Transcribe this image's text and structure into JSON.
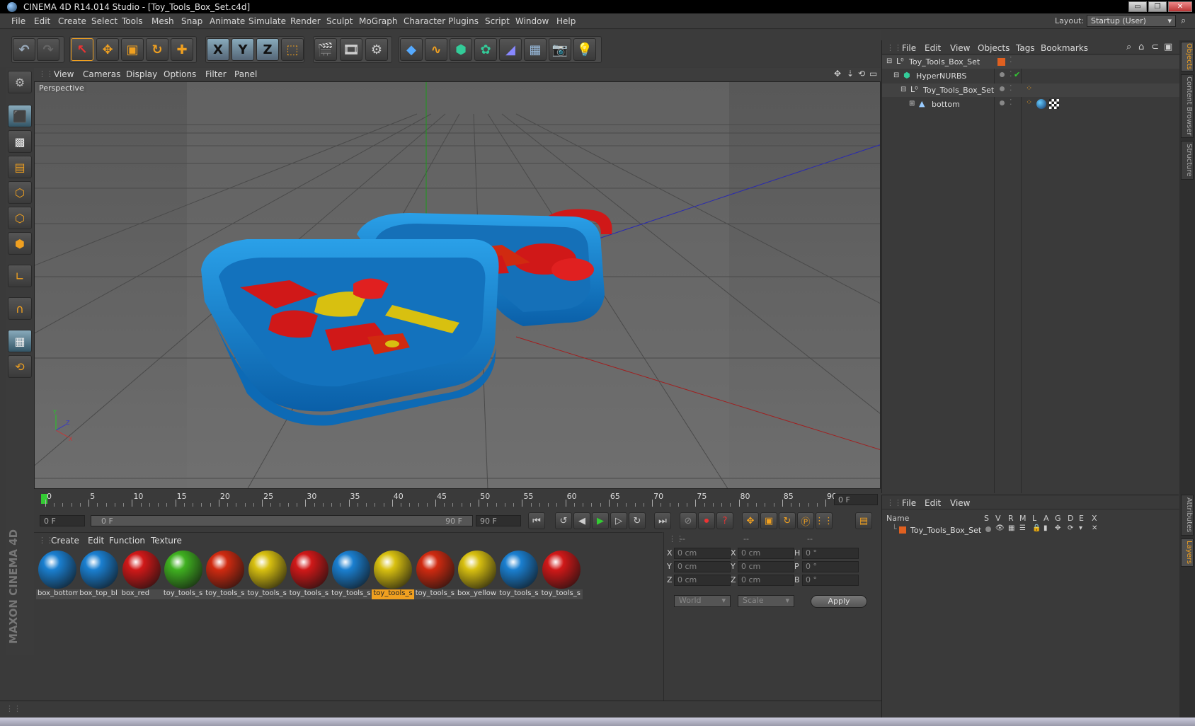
{
  "window": {
    "title": "CINEMA 4D R14.014 Studio - [Toy_Tools_Box_Set.c4d]",
    "minimize": "▭",
    "restore": "❐",
    "close": "✕"
  },
  "menubar": {
    "items": [
      "File",
      "Edit",
      "Create",
      "Select",
      "Tools",
      "Mesh",
      "Snap",
      "Animate",
      "Simulate",
      "Render",
      "Sculpt",
      "MoGraph",
      "Character",
      "Plugins",
      "Script",
      "Window",
      "Help"
    ],
    "layout_label": "Layout:",
    "layout_value": "Startup (User)"
  },
  "toolbar": {
    "axis_x": "X",
    "axis_y": "Y",
    "axis_z": "Z"
  },
  "viewport": {
    "menu": [
      "View",
      "Cameras",
      "Display",
      "Options",
      "Filter",
      "Panel"
    ],
    "camera_label": "Perspective",
    "axis_y": "Y",
    "axis_x": "X",
    "axis_z": "Z"
  },
  "timeline": {
    "ticks": [
      "0",
      "5",
      "10",
      "15",
      "20",
      "25",
      "30",
      "35",
      "40",
      "45",
      "50",
      "55",
      "60",
      "65",
      "70",
      "75",
      "80",
      "85",
      "90"
    ],
    "current_frame": "0 F",
    "start_frame": "0 F",
    "range_start": "0 F",
    "range_end": "90 F",
    "end_frame": "90 F"
  },
  "materials": {
    "menu": [
      "Create",
      "Edit",
      "Function",
      "Texture"
    ],
    "items": [
      {
        "name": "box_bottom",
        "color": "#1a7fd0"
      },
      {
        "name": "box_top_bl",
        "color": "#1a7fd0"
      },
      {
        "name": "box_red",
        "color": "#d01818"
      },
      {
        "name": "toy_tools_s",
        "color": "#3fb020"
      },
      {
        "name": "toy_tools_s",
        "color": "#d02a10"
      },
      {
        "name": "toy_tools_s",
        "color": "#d8c010"
      },
      {
        "name": "toy_tools_s",
        "color": "#d01818"
      },
      {
        "name": "toy_tools_s",
        "color": "#1a7fd0"
      },
      {
        "name": "toy_tools_s",
        "color": "#d8c010",
        "selected": true
      },
      {
        "name": "toy_tools_s",
        "color": "#d02a10"
      },
      {
        "name": "box_yellow",
        "color": "#d8c010"
      },
      {
        "name": "toy_tools_s",
        "color": "#1a7fd0"
      },
      {
        "name": "toy_tools_s",
        "color": "#d01818"
      }
    ]
  },
  "coords": {
    "headers": [
      "--",
      "--",
      "--"
    ],
    "rows": [
      {
        "a": "X",
        "pos": "0 cm",
        "b": "X",
        "size": "0 cm",
        "c": "H",
        "rot": "0 °"
      },
      {
        "a": "Y",
        "pos": "0 cm",
        "b": "Y",
        "size": "0 cm",
        "c": "P",
        "rot": "0 °"
      },
      {
        "a": "Z",
        "pos": "0 cm",
        "b": "Z",
        "size": "0 cm",
        "c": "B",
        "rot": "0 °"
      }
    ],
    "mode1": "World",
    "mode2": "Scale",
    "apply": "Apply"
  },
  "objects": {
    "menu": [
      "File",
      "Edit",
      "View",
      "Objects",
      "Tags",
      "Bookmarks"
    ],
    "tree": [
      {
        "name": "Toy_Tools_Box_Set"
      },
      {
        "name": "HyperNURBS"
      },
      {
        "name": "Toy_Tools_Box_Set"
      },
      {
        "name": "bottom"
      }
    ]
  },
  "layers": {
    "menu": [
      "File",
      "Edit",
      "View"
    ],
    "headers": [
      "Name",
      "S",
      "V",
      "R",
      "M",
      "L",
      "A",
      "G",
      "D",
      "E",
      "X"
    ],
    "rows": [
      {
        "name": "Toy_Tools_Box_Set"
      }
    ]
  },
  "side_tabs": [
    "Objects",
    "Content Browser",
    "Structure",
    "Attributes",
    "Layers"
  ],
  "branding": "MAXON CINEMA 4D",
  "colors": {
    "accent": "#f0a020",
    "box_blue": "#1a7fd0",
    "toy_red": "#d01818",
    "toy_yellow": "#d8c010"
  }
}
